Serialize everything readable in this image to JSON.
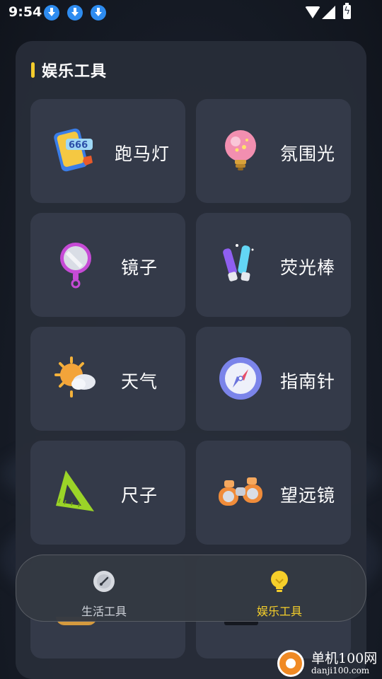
{
  "status_bar": {
    "time": "9:54",
    "icons": [
      "download-icon",
      "download-icon",
      "download-icon",
      "wifi-icon",
      "signal-icon",
      "battery-charging-icon"
    ]
  },
  "section": {
    "title": "娱乐工具"
  },
  "tools": [
    {
      "label": "跑马灯",
      "icon": "marquee-phone-icon"
    },
    {
      "label": "氛围光",
      "icon": "light-bulb-icon"
    },
    {
      "label": "镜子",
      "icon": "hand-mirror-icon"
    },
    {
      "label": "荧光棒",
      "icon": "glow-stick-icon"
    },
    {
      "label": "天气",
      "icon": "weather-sun-cloud-icon"
    },
    {
      "label": "指南针",
      "icon": "compass-icon"
    },
    {
      "label": "尺子",
      "icon": "triangle-ruler-icon"
    },
    {
      "label": "望远镜",
      "icon": "binoculars-icon"
    }
  ],
  "bottom_nav": {
    "items": [
      {
        "label": "生活工具",
        "icon": "gauge-icon",
        "active": false
      },
      {
        "label": "娱乐工具",
        "icon": "light-bulb-icon",
        "active": true
      }
    ]
  },
  "watermark": {
    "title": "单机100网",
    "url": "danji100.com"
  },
  "colors": {
    "accent": "#f6cf2a",
    "card": "#343a49",
    "panel": "#282d38",
    "download": "#2e8cf0"
  }
}
